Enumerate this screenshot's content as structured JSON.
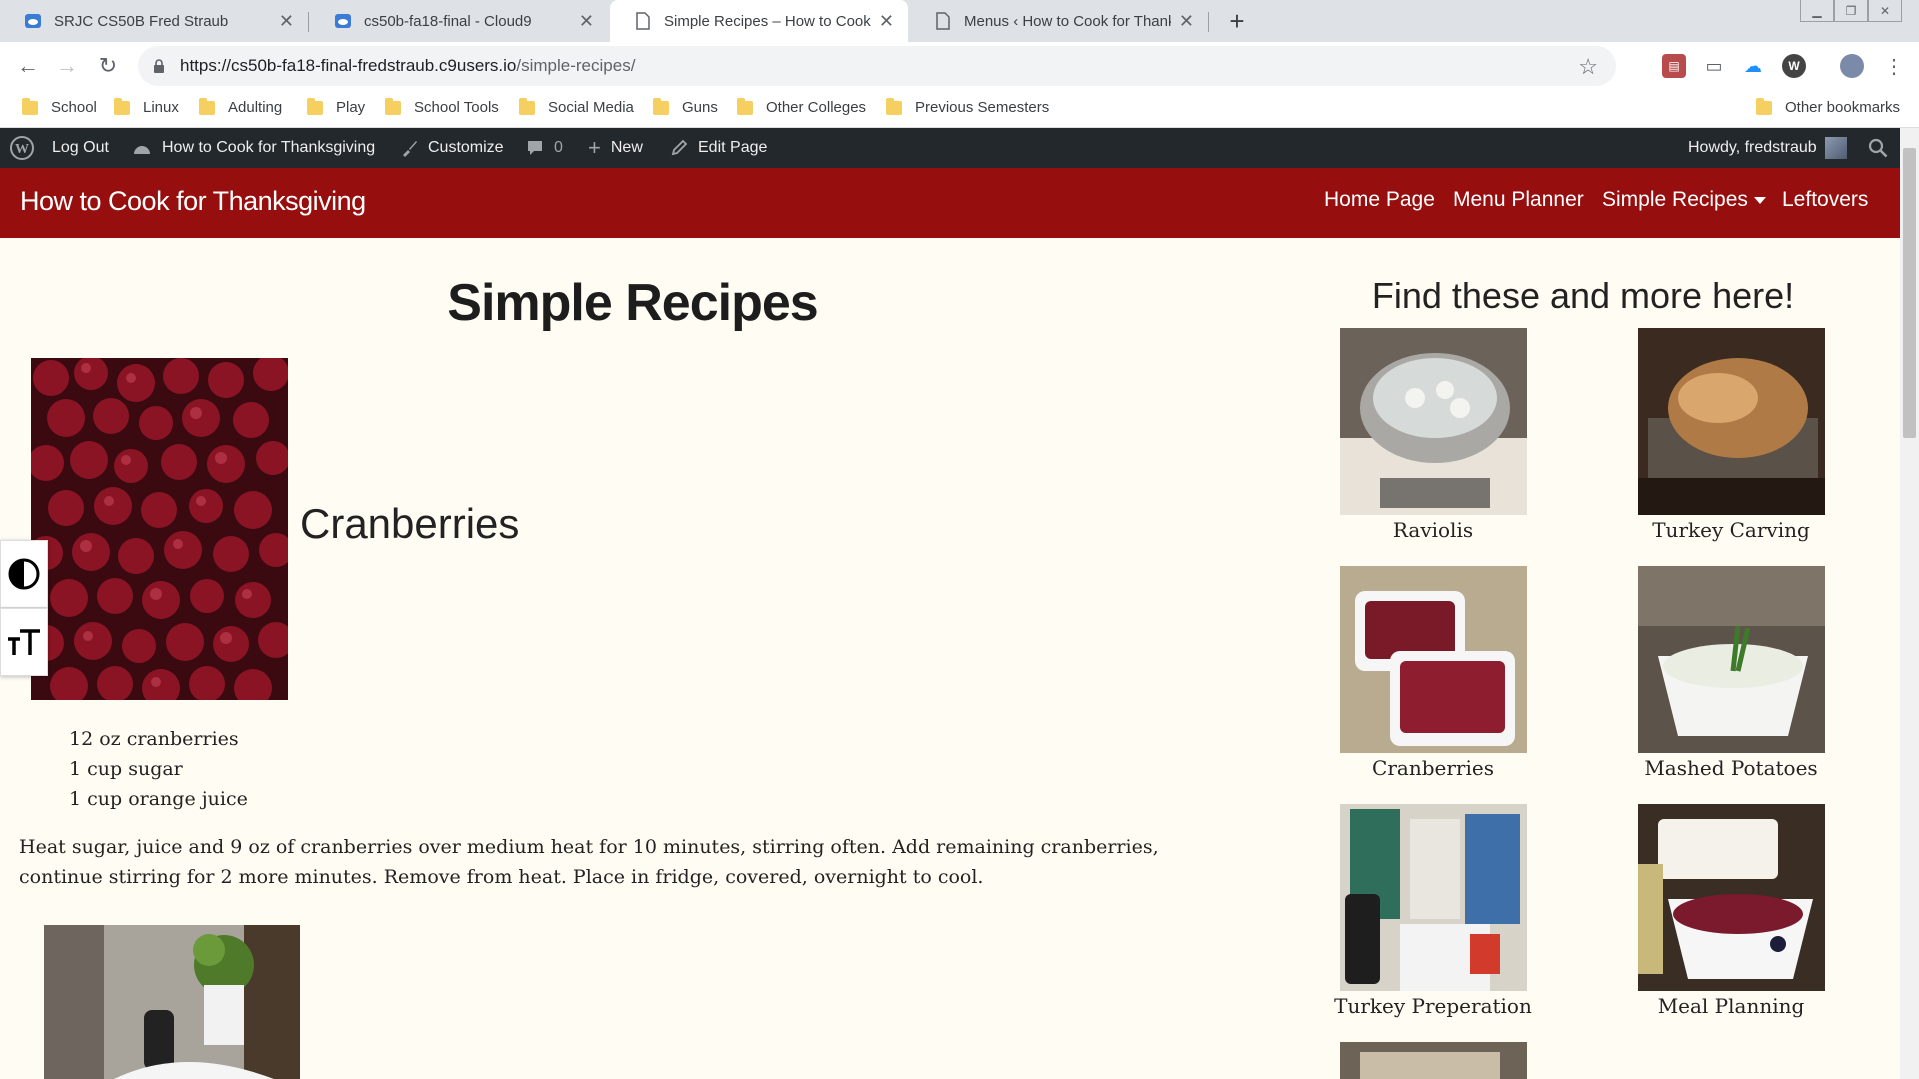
{
  "browser": {
    "tabs": [
      {
        "title": "SRJC CS50B Fred Straub",
        "icon": "cloud9-icon"
      },
      {
        "title": "cs50b-fa18-final - Cloud9",
        "icon": "cloud9-icon"
      },
      {
        "title": "Simple Recipes – How to Cook fo",
        "icon": "page-icon"
      },
      {
        "title": "Menus ‹ How to Cook for Thanks",
        "icon": "page-icon"
      }
    ],
    "url_host": "https://cs50b-fa18-final-fredstraub.c9users.io",
    "url_path": "/simple-recipes/",
    "bookmarks": [
      "School",
      "Linux",
      "Adulting",
      "Play",
      "School Tools",
      "Social Media",
      "Guns",
      "Other Colleges",
      "Previous Semesters"
    ],
    "other_bookmarks": "Other bookmarks"
  },
  "adminbar": {
    "logout": "Log Out",
    "site_name": "How to Cook for Thanksgiving",
    "customize": "Customize",
    "comments_count": "0",
    "new": "New",
    "edit_page": "Edit Page",
    "howdy": "Howdy, fredstraub"
  },
  "site": {
    "brand": "How to Cook for Thanksgiving",
    "nav": [
      "Home Page",
      "Menu Planner",
      "Simple Recipes",
      "Leftovers"
    ]
  },
  "main": {
    "title": "Simple Recipes",
    "recipe_name": "Cranberries",
    "ingredients": [
      "12 oz cranberries",
      "1 cup sugar",
      "1 cup orange juice"
    ],
    "instructions_line1": "Heat sugar, juice and 9 oz of cranberries over medium heat for 10 minutes, stirring often.  Add remaining cranberries,",
    "instructions_line2": "continue stirring for 2 more minutes.  Remove from heat.  Place in fridge, covered, overnight to cool."
  },
  "sidebar": {
    "title": "Find these and more here!",
    "items": [
      "Raviolis",
      "Turkey Carving",
      "Cranberries",
      "Mashed Potatoes",
      "Turkey Preperation",
      "Meal Planning"
    ]
  },
  "colors": {
    "header_red": "#960e0e",
    "adminbar": "#23282d",
    "page_bg": "#fffdf3"
  }
}
